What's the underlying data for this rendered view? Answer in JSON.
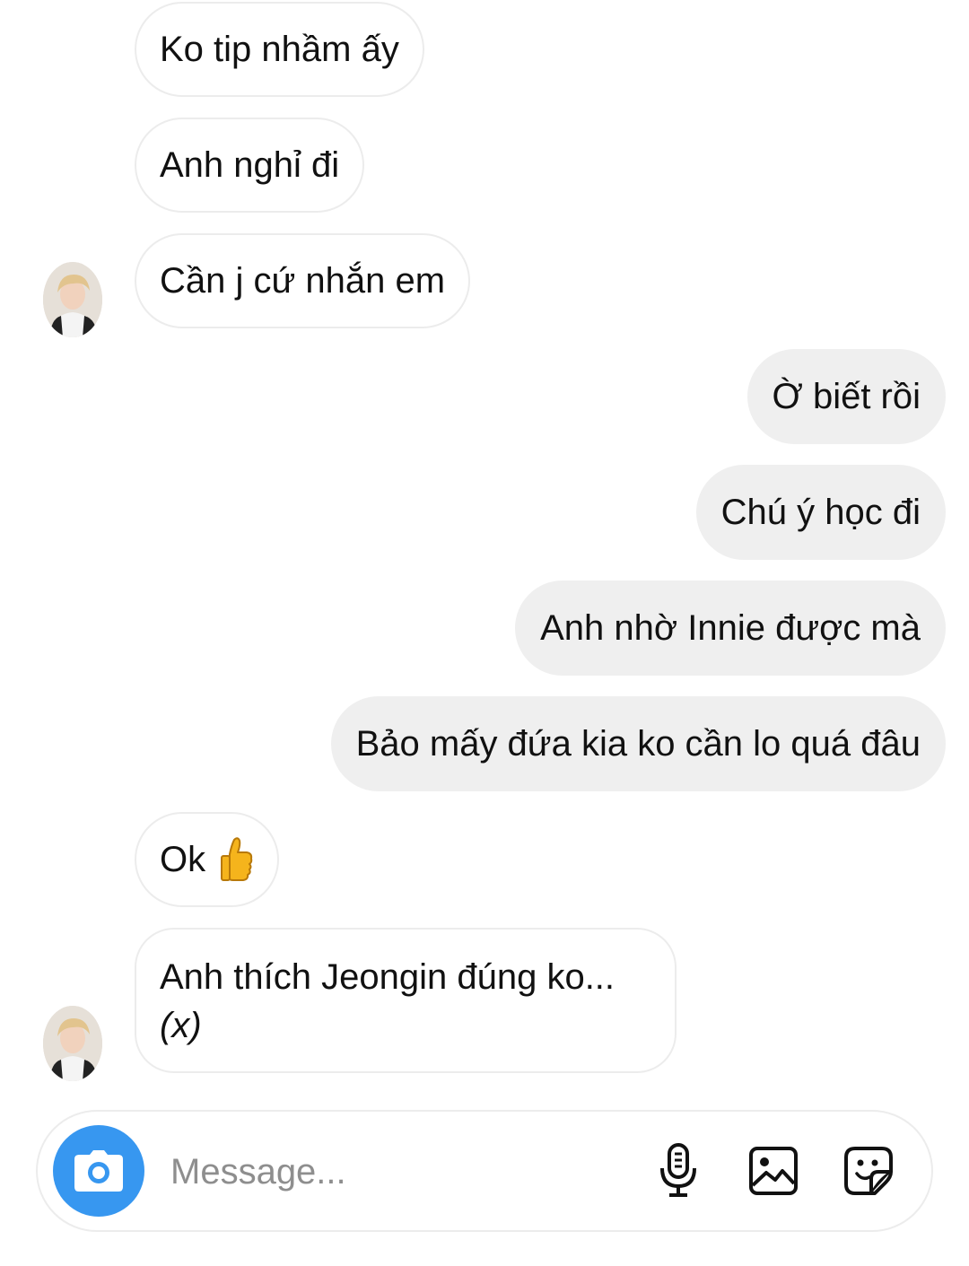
{
  "thread": {
    "messages": [
      {
        "text": "Ko tip nhầm ấy"
      },
      {
        "text": "Anh nghỉ đi"
      },
      {
        "text": "Cần j cứ nhắn em"
      },
      {
        "text": "Ờ biết rồi"
      },
      {
        "text": "Chú ý học đi"
      },
      {
        "text": "Anh nhờ Innie được mà"
      },
      {
        "text": "Bảo mấy đứa kia ko cần lo quá đâu"
      },
      {
        "text": "Ok"
      },
      {
        "line1": "Anh thích Jeongin đúng ko...",
        "line2": "(x)"
      }
    ]
  },
  "composer": {
    "placeholder": "Message...",
    "camera_icon": "camera-icon",
    "mic_icon": "microphone-icon",
    "gallery_icon": "gallery-icon",
    "sticker_icon": "sticker-icon"
  },
  "colors": {
    "accent": "#3797f0",
    "outgoing_bubble": "#efefef",
    "incoming_border": "#ececec",
    "placeholder": "#8e8e8e"
  }
}
